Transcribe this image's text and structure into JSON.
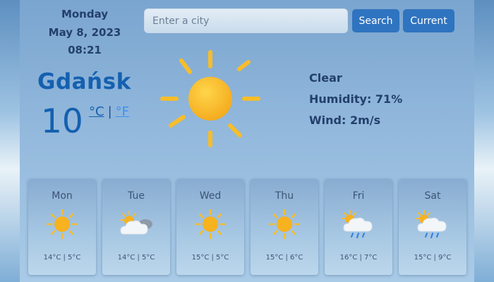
{
  "date": {
    "weekday": "Monday",
    "full_date": "May 8, 2023",
    "time": "08:21"
  },
  "search": {
    "placeholder": "Enter a city",
    "value": "",
    "search_label": "Search",
    "current_label": "Current"
  },
  "current": {
    "city": "Gdańsk",
    "temperature": "10",
    "unit_celsius": "°C",
    "unit_separator": "|",
    "unit_fahrenheit": "°F",
    "icon": "sun-icon",
    "description": "Clear",
    "humidity": "Humidity: 71%",
    "wind": "Wind: 2m/s"
  },
  "forecast": [
    {
      "day": "Mon",
      "icon": "sun-icon",
      "temps": "14°C | 5°C"
    },
    {
      "day": "Tue",
      "icon": "cloudy-icon",
      "temps": "14°C | 5°C"
    },
    {
      "day": "Wed",
      "icon": "sun-icon",
      "temps": "15°C | 5°C"
    },
    {
      "day": "Thu",
      "icon": "sun-icon",
      "temps": "15°C | 6°C"
    },
    {
      "day": "Fri",
      "icon": "rain-icon",
      "temps": "16°C | 7°C"
    },
    {
      "day": "Sat",
      "icon": "rain-icon",
      "temps": "15°C | 9°C"
    }
  ],
  "colors": {
    "accent": "#2f74c0",
    "city_text": "#1560b0",
    "sun": "#f6b91e"
  }
}
